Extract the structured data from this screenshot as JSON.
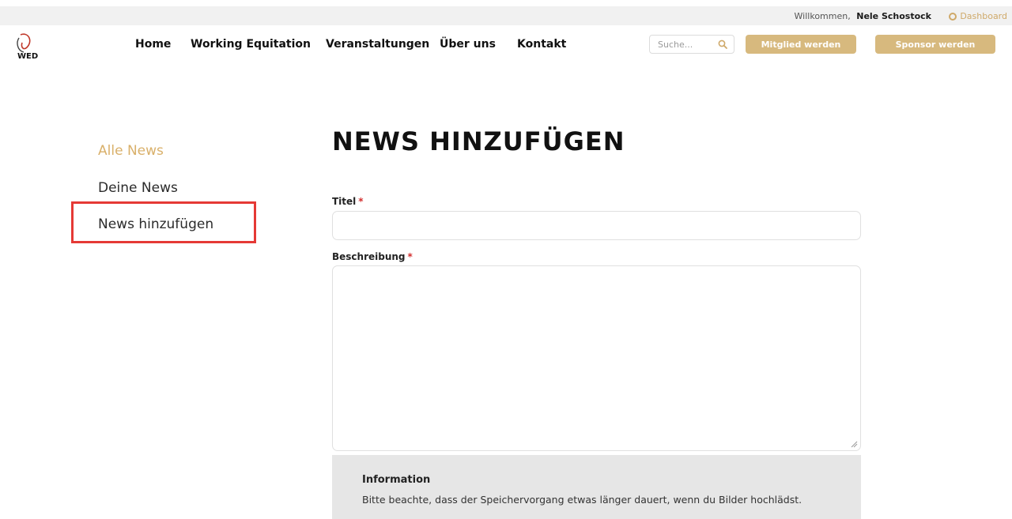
{
  "topbar": {
    "welcome_text": "Willkommen,",
    "user_name": "Nele Schostock",
    "dashboard_label": "Dashboard"
  },
  "logo": {
    "text": "WED"
  },
  "nav": {
    "items": [
      {
        "label": "Home"
      },
      {
        "label": "Working Equitation"
      },
      {
        "label": "Veranstaltungen"
      },
      {
        "label": "Über uns"
      },
      {
        "label": "Kontakt"
      }
    ]
  },
  "search": {
    "placeholder": "Suche..."
  },
  "buttons": {
    "member": "Mitglied werden",
    "sponsor": "Sponsor werden"
  },
  "sidebar": {
    "items": [
      {
        "label": "Alle News",
        "active": true
      },
      {
        "label": "Deine News",
        "active": false
      },
      {
        "label": "News hinzufügen",
        "active": false
      }
    ]
  },
  "main": {
    "title": "NEWS HINZUFÜGEN",
    "fields": {
      "title_label": "Titel",
      "title_value": "",
      "description_label": "Beschreibung",
      "description_value": "",
      "required_mark": "*"
    },
    "info": {
      "title": "Information",
      "text": "Bitte beachte, dass der Speichervorgang etwas länger dauert, wenn du Bilder hochlädst."
    }
  },
  "colors": {
    "accent_gold": "#d7b97e",
    "active_link": "#d9b06a",
    "highlight_red": "#e53935",
    "required_red": "#d32f2f",
    "info_bg": "#e6e6e6"
  }
}
